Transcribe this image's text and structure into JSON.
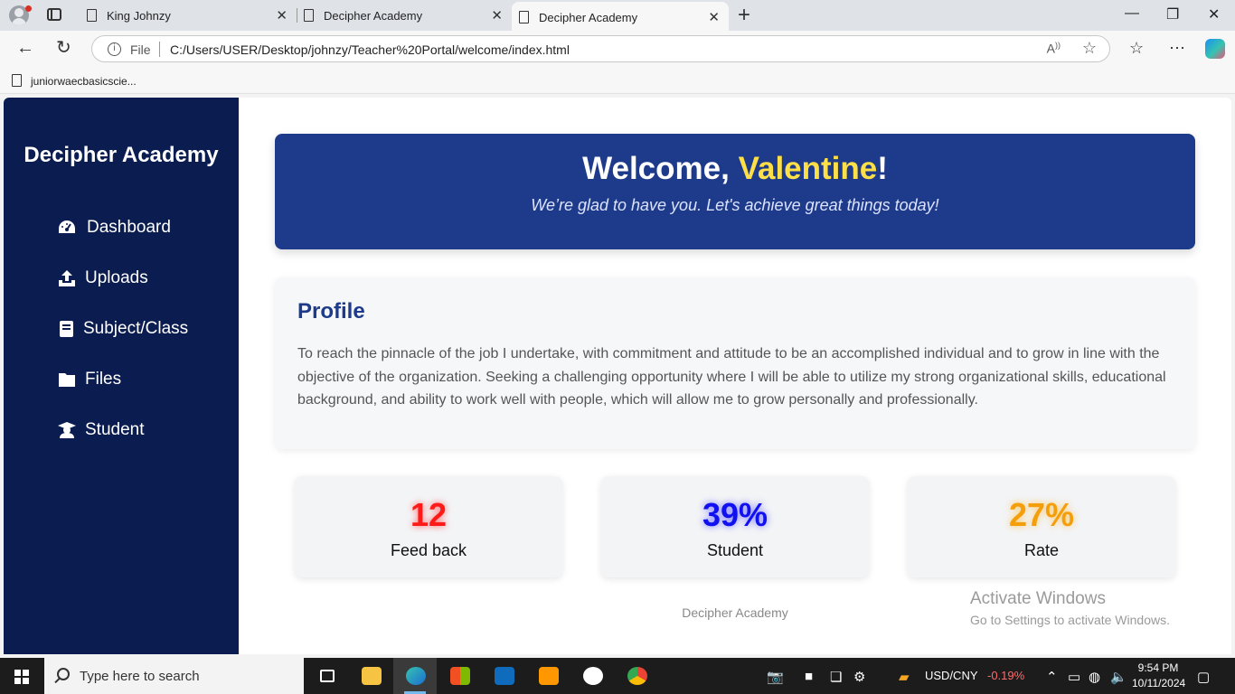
{
  "browser": {
    "tabs": [
      {
        "label": "King Johnzy"
      },
      {
        "label": "Decipher Academy"
      },
      {
        "label": "Decipher Academy"
      }
    ],
    "address": {
      "scheme_label": "File",
      "url": "C:/Users/USER/Desktop/johnzy/Teacher%20Portal/welcome/index.html"
    },
    "bookmark": {
      "label": "juniorwaecbasicscie..."
    }
  },
  "sidebar": {
    "brand": "Decipher Academy",
    "items": [
      {
        "label": "Dashboard",
        "icon": "dashboard-icon"
      },
      {
        "label": "Uploads",
        "icon": "upload-icon"
      },
      {
        "label": "Subject/Class",
        "icon": "book-icon"
      },
      {
        "label": "Files",
        "icon": "folder-icon"
      },
      {
        "label": "Student",
        "icon": "student-icon"
      }
    ]
  },
  "welcome": {
    "greeting": "Welcome, ",
    "name": "Valentine",
    "exclaim": "!",
    "subtitle": "We’re glad to have you. Let's achieve great things today!",
    "colors": {
      "background": "#1e3a8a",
      "name": "#fde047"
    }
  },
  "profile": {
    "title": "Profile",
    "text": "To reach the pinnacle of the job I undertake, with commitment and attitude to be an accomplished individual and to grow in line with the objective of the organization. Seeking a challenging opportunity where I will be able to utilize my strong organizational skills, educational background, and ability to work well with people, which will allow me to grow personally and professionally."
  },
  "stats": [
    {
      "value": "12",
      "label": "Feed back",
      "color": "#ff1a1a"
    },
    {
      "value": "39%",
      "label": "Student",
      "color": "#1010f0"
    },
    {
      "value": "27%",
      "label": "Rate",
      "color": "#f59e0b"
    }
  ],
  "footer": {
    "text": "Decipher Academy"
  },
  "watermark": {
    "line1": "Activate Windows",
    "line2": "Go to Settings to activate Windows."
  },
  "taskbar": {
    "search_placeholder": "Type here to search",
    "ticker": {
      "symbol": "USD/CNY",
      "change": "-0.19%"
    },
    "clock": {
      "time": "9:54 PM",
      "date": "10/11/2024"
    }
  }
}
